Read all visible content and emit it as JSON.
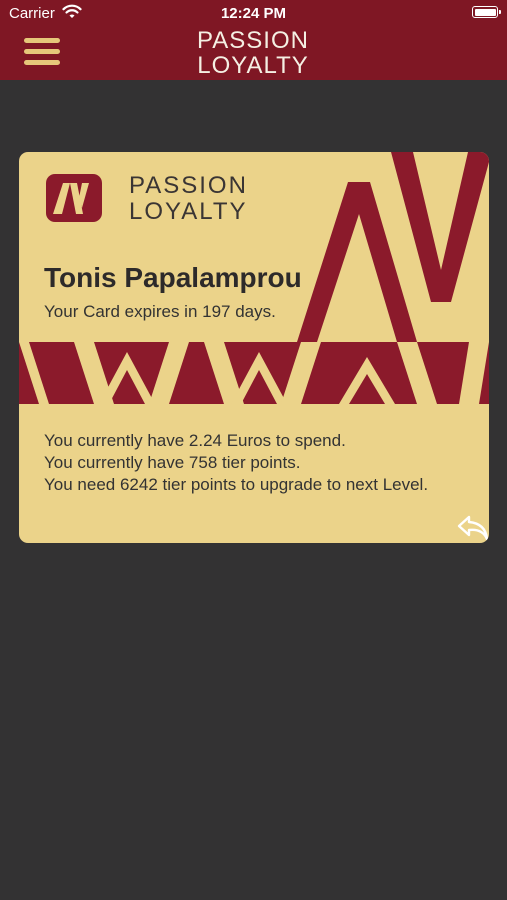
{
  "status_bar": {
    "carrier": "Carrier",
    "time": "12:24 PM"
  },
  "nav": {
    "menu_icon": "hamburger-icon",
    "logo_line1": "PASSION",
    "logo_line2": "LOYALTY"
  },
  "card": {
    "brand_line1": "PASSION",
    "brand_line2": "LOYALTY",
    "holder_name": "Tonis Papalamprou",
    "expiry_text": "Your Card expires in 197 days.",
    "info_lines": [
      "You currently have 2.24 Euros to spend.",
      "You currently have 758 tier points.",
      "You need 6242 tier points to upgrade to next Level."
    ],
    "flip_icon": "reply-arrow-icon"
  },
  "colors": {
    "header": "#7f1724",
    "background": "#333233",
    "card": "#ebd38a",
    "accent": "#8b1a2b",
    "gold": "#e6c77a"
  }
}
